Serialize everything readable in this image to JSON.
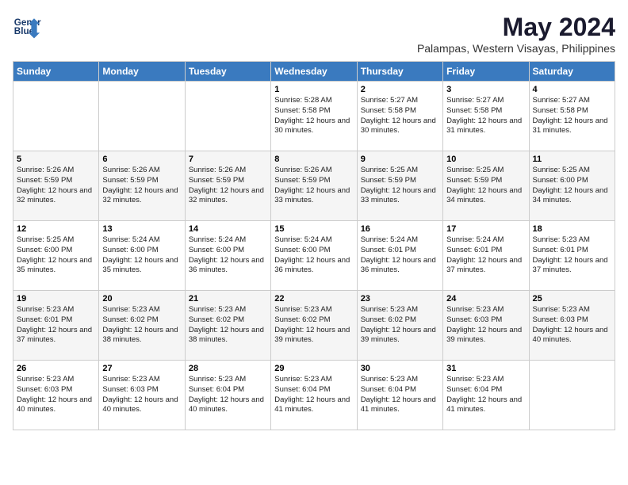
{
  "header": {
    "logo_line1": "General",
    "logo_line2": "Blue",
    "month_title": "May 2024",
    "subtitle": "Palampas, Western Visayas, Philippines"
  },
  "days_of_week": [
    "Sunday",
    "Monday",
    "Tuesday",
    "Wednesday",
    "Thursday",
    "Friday",
    "Saturday"
  ],
  "weeks": [
    [
      {
        "day": "",
        "sunrise": "",
        "sunset": "",
        "daylight": ""
      },
      {
        "day": "",
        "sunrise": "",
        "sunset": "",
        "daylight": ""
      },
      {
        "day": "",
        "sunrise": "",
        "sunset": "",
        "daylight": ""
      },
      {
        "day": "1",
        "sunrise": "Sunrise: 5:28 AM",
        "sunset": "Sunset: 5:58 PM",
        "daylight": "Daylight: 12 hours and 30 minutes."
      },
      {
        "day": "2",
        "sunrise": "Sunrise: 5:27 AM",
        "sunset": "Sunset: 5:58 PM",
        "daylight": "Daylight: 12 hours and 30 minutes."
      },
      {
        "day": "3",
        "sunrise": "Sunrise: 5:27 AM",
        "sunset": "Sunset: 5:58 PM",
        "daylight": "Daylight: 12 hours and 31 minutes."
      },
      {
        "day": "4",
        "sunrise": "Sunrise: 5:27 AM",
        "sunset": "Sunset: 5:58 PM",
        "daylight": "Daylight: 12 hours and 31 minutes."
      }
    ],
    [
      {
        "day": "5",
        "sunrise": "Sunrise: 5:26 AM",
        "sunset": "Sunset: 5:59 PM",
        "daylight": "Daylight: 12 hours and 32 minutes."
      },
      {
        "day": "6",
        "sunrise": "Sunrise: 5:26 AM",
        "sunset": "Sunset: 5:59 PM",
        "daylight": "Daylight: 12 hours and 32 minutes."
      },
      {
        "day": "7",
        "sunrise": "Sunrise: 5:26 AM",
        "sunset": "Sunset: 5:59 PM",
        "daylight": "Daylight: 12 hours and 32 minutes."
      },
      {
        "day": "8",
        "sunrise": "Sunrise: 5:26 AM",
        "sunset": "Sunset: 5:59 PM",
        "daylight": "Daylight: 12 hours and 33 minutes."
      },
      {
        "day": "9",
        "sunrise": "Sunrise: 5:25 AM",
        "sunset": "Sunset: 5:59 PM",
        "daylight": "Daylight: 12 hours and 33 minutes."
      },
      {
        "day": "10",
        "sunrise": "Sunrise: 5:25 AM",
        "sunset": "Sunset: 5:59 PM",
        "daylight": "Daylight: 12 hours and 34 minutes."
      },
      {
        "day": "11",
        "sunrise": "Sunrise: 5:25 AM",
        "sunset": "Sunset: 6:00 PM",
        "daylight": "Daylight: 12 hours and 34 minutes."
      }
    ],
    [
      {
        "day": "12",
        "sunrise": "Sunrise: 5:25 AM",
        "sunset": "Sunset: 6:00 PM",
        "daylight": "Daylight: 12 hours and 35 minutes."
      },
      {
        "day": "13",
        "sunrise": "Sunrise: 5:24 AM",
        "sunset": "Sunset: 6:00 PM",
        "daylight": "Daylight: 12 hours and 35 minutes."
      },
      {
        "day": "14",
        "sunrise": "Sunrise: 5:24 AM",
        "sunset": "Sunset: 6:00 PM",
        "daylight": "Daylight: 12 hours and 36 minutes."
      },
      {
        "day": "15",
        "sunrise": "Sunrise: 5:24 AM",
        "sunset": "Sunset: 6:00 PM",
        "daylight": "Daylight: 12 hours and 36 minutes."
      },
      {
        "day": "16",
        "sunrise": "Sunrise: 5:24 AM",
        "sunset": "Sunset: 6:01 PM",
        "daylight": "Daylight: 12 hours and 36 minutes."
      },
      {
        "day": "17",
        "sunrise": "Sunrise: 5:24 AM",
        "sunset": "Sunset: 6:01 PM",
        "daylight": "Daylight: 12 hours and 37 minutes."
      },
      {
        "day": "18",
        "sunrise": "Sunrise: 5:23 AM",
        "sunset": "Sunset: 6:01 PM",
        "daylight": "Daylight: 12 hours and 37 minutes."
      }
    ],
    [
      {
        "day": "19",
        "sunrise": "Sunrise: 5:23 AM",
        "sunset": "Sunset: 6:01 PM",
        "daylight": "Daylight: 12 hours and 37 minutes."
      },
      {
        "day": "20",
        "sunrise": "Sunrise: 5:23 AM",
        "sunset": "Sunset: 6:02 PM",
        "daylight": "Daylight: 12 hours and 38 minutes."
      },
      {
        "day": "21",
        "sunrise": "Sunrise: 5:23 AM",
        "sunset": "Sunset: 6:02 PM",
        "daylight": "Daylight: 12 hours and 38 minutes."
      },
      {
        "day": "22",
        "sunrise": "Sunrise: 5:23 AM",
        "sunset": "Sunset: 6:02 PM",
        "daylight": "Daylight: 12 hours and 39 minutes."
      },
      {
        "day": "23",
        "sunrise": "Sunrise: 5:23 AM",
        "sunset": "Sunset: 6:02 PM",
        "daylight": "Daylight: 12 hours and 39 minutes."
      },
      {
        "day": "24",
        "sunrise": "Sunrise: 5:23 AM",
        "sunset": "Sunset: 6:03 PM",
        "daylight": "Daylight: 12 hours and 39 minutes."
      },
      {
        "day": "25",
        "sunrise": "Sunrise: 5:23 AM",
        "sunset": "Sunset: 6:03 PM",
        "daylight": "Daylight: 12 hours and 40 minutes."
      }
    ],
    [
      {
        "day": "26",
        "sunrise": "Sunrise: 5:23 AM",
        "sunset": "Sunset: 6:03 PM",
        "daylight": "Daylight: 12 hours and 40 minutes."
      },
      {
        "day": "27",
        "sunrise": "Sunrise: 5:23 AM",
        "sunset": "Sunset: 6:03 PM",
        "daylight": "Daylight: 12 hours and 40 minutes."
      },
      {
        "day": "28",
        "sunrise": "Sunrise: 5:23 AM",
        "sunset": "Sunset: 6:04 PM",
        "daylight": "Daylight: 12 hours and 40 minutes."
      },
      {
        "day": "29",
        "sunrise": "Sunrise: 5:23 AM",
        "sunset": "Sunset: 6:04 PM",
        "daylight": "Daylight: 12 hours and 41 minutes."
      },
      {
        "day": "30",
        "sunrise": "Sunrise: 5:23 AM",
        "sunset": "Sunset: 6:04 PM",
        "daylight": "Daylight: 12 hours and 41 minutes."
      },
      {
        "day": "31",
        "sunrise": "Sunrise: 5:23 AM",
        "sunset": "Sunset: 6:04 PM",
        "daylight": "Daylight: 12 hours and 41 minutes."
      },
      {
        "day": "",
        "sunrise": "",
        "sunset": "",
        "daylight": ""
      }
    ]
  ]
}
